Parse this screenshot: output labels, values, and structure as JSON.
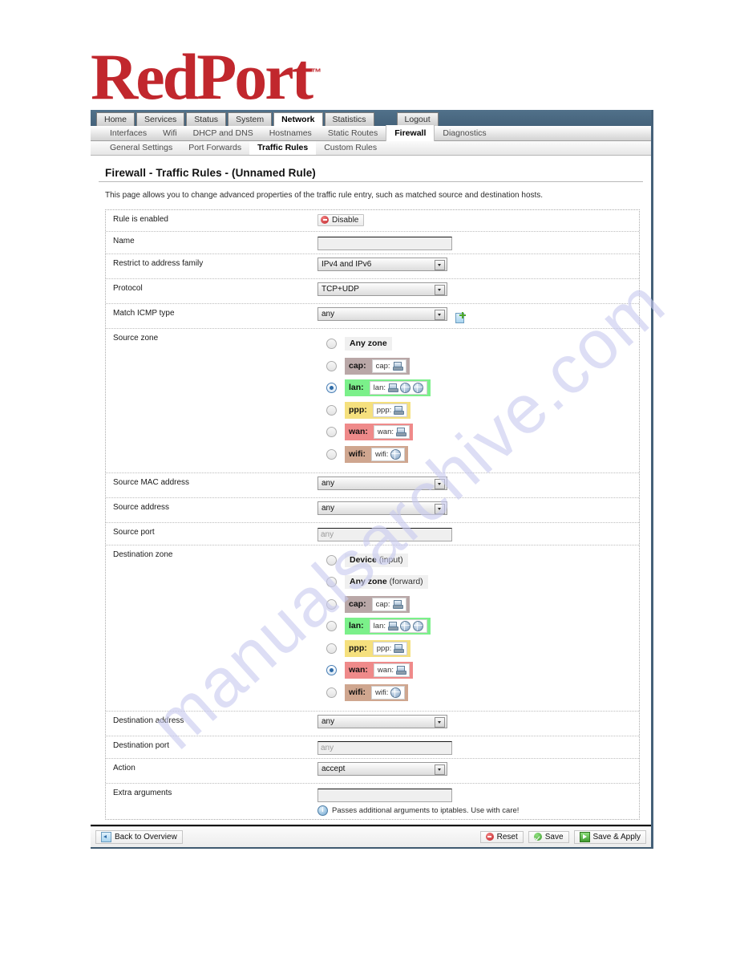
{
  "brand": {
    "name_part1": "Red",
    "name_part2": "Port",
    "trademark": "™"
  },
  "nav_primary": [
    {
      "label": "Home",
      "active": false
    },
    {
      "label": "Services",
      "active": false
    },
    {
      "label": "Status",
      "active": false
    },
    {
      "label": "System",
      "active": false
    },
    {
      "label": "Network",
      "active": true
    },
    {
      "label": "Statistics",
      "active": false
    },
    {
      "label": "Logout",
      "active": false
    }
  ],
  "nav_secondary": [
    {
      "label": "Interfaces",
      "active": false
    },
    {
      "label": "Wifi",
      "active": false
    },
    {
      "label": "DHCP and DNS",
      "active": false
    },
    {
      "label": "Hostnames",
      "active": false
    },
    {
      "label": "Static Routes",
      "active": false
    },
    {
      "label": "Firewall",
      "active": true
    },
    {
      "label": "Diagnostics",
      "active": false
    }
  ],
  "nav_tertiary": [
    {
      "label": "General Settings",
      "active": false
    },
    {
      "label": "Port Forwards",
      "active": false
    },
    {
      "label": "Traffic Rules",
      "active": true
    },
    {
      "label": "Custom Rules",
      "active": false
    }
  ],
  "page": {
    "title": "Firewall - Traffic Rules - (Unnamed Rule)",
    "description": "This page allows you to change advanced properties of the traffic rule entry, such as matched source and destination hosts."
  },
  "form": {
    "rule_enabled": {
      "label": "Rule is enabled",
      "button_label": "Disable"
    },
    "name": {
      "label": "Name",
      "value": "",
      "placeholder": ""
    },
    "address_family": {
      "label": "Restrict to address family",
      "value": "IPv4 and IPv6"
    },
    "protocol": {
      "label": "Protocol",
      "value": "TCP+UDP"
    },
    "icmp_type": {
      "label": "Match ICMP type",
      "value": "any",
      "add_icon": "add-page-icon"
    },
    "source_zone": {
      "label": "Source zone"
    },
    "source_mac": {
      "label": "Source MAC address",
      "value": "any"
    },
    "source_address": {
      "label": "Source address",
      "value": "any"
    },
    "source_port": {
      "label": "Source port",
      "value": "",
      "placeholder": "any"
    },
    "destination_zone": {
      "label": "Destination zone"
    },
    "destination_address": {
      "label": "Destination address",
      "value": "any"
    },
    "destination_port": {
      "label": "Destination port",
      "value": "",
      "placeholder": "any"
    },
    "action": {
      "label": "Action",
      "value": "accept"
    },
    "extra_arguments": {
      "label": "Extra arguments",
      "value": "",
      "placeholder": "",
      "hint": "Passes additional arguments to iptables. Use with care!"
    }
  },
  "source_zones": [
    {
      "kind": "plain",
      "name": "Any zone",
      "sub": "",
      "selected": false
    },
    {
      "kind": "badge",
      "name": "cap:",
      "inner_label": "cap:",
      "color": "cap",
      "icons": [
        "eth"
      ],
      "selected": false
    },
    {
      "kind": "badge",
      "name": "lan:",
      "inner_label": "lan:",
      "color": "lan",
      "icons": [
        "eth",
        "globe",
        "globe"
      ],
      "selected": true
    },
    {
      "kind": "badge",
      "name": "ppp:",
      "inner_label": "ppp:",
      "color": "ppp",
      "icons": [
        "eth"
      ],
      "selected": false
    },
    {
      "kind": "badge",
      "name": "wan:",
      "inner_label": "wan:",
      "color": "wan",
      "icons": [
        "eth"
      ],
      "selected": false
    },
    {
      "kind": "badge",
      "name": "wifi:",
      "inner_label": "wifi:",
      "color": "wifi",
      "icons": [
        "globe"
      ],
      "selected": false
    }
  ],
  "destination_zones": [
    {
      "kind": "plain",
      "name": "Device",
      "sub": "(input)",
      "selected": false
    },
    {
      "kind": "plain",
      "name": "Any zone",
      "sub": "(forward)",
      "selected": false
    },
    {
      "kind": "badge",
      "name": "cap:",
      "inner_label": "cap:",
      "color": "cap",
      "icons": [
        "eth"
      ],
      "selected": false
    },
    {
      "kind": "badge",
      "name": "lan:",
      "inner_label": "lan:",
      "color": "lan",
      "icons": [
        "eth",
        "globe",
        "globe"
      ],
      "selected": false
    },
    {
      "kind": "badge",
      "name": "ppp:",
      "inner_label": "ppp:",
      "color": "ppp",
      "icons": [
        "eth"
      ],
      "selected": false
    },
    {
      "kind": "badge",
      "name": "wan:",
      "inner_label": "wan:",
      "color": "wan",
      "icons": [
        "eth"
      ],
      "selected": true
    },
    {
      "kind": "badge",
      "name": "wifi:",
      "inner_label": "wifi:",
      "color": "wifi",
      "icons": [
        "globe"
      ],
      "selected": false
    }
  ],
  "footer": {
    "back_label": "Back to Overview",
    "reset_label": "Reset",
    "save_label": "Save",
    "save_apply_label": "Save & Apply"
  },
  "watermark": {
    "text": "manualsarchive.com"
  },
  "colors": {
    "brand_red": "#c1272d",
    "nav_bar": "#4a6a84",
    "zone_cap": "#b9a7a7",
    "zone_lan": "#7bf08a",
    "zone_ppp": "#f5e07e",
    "zone_wan": "#ef8a8a",
    "zone_wifi": "#cfa68f"
  }
}
